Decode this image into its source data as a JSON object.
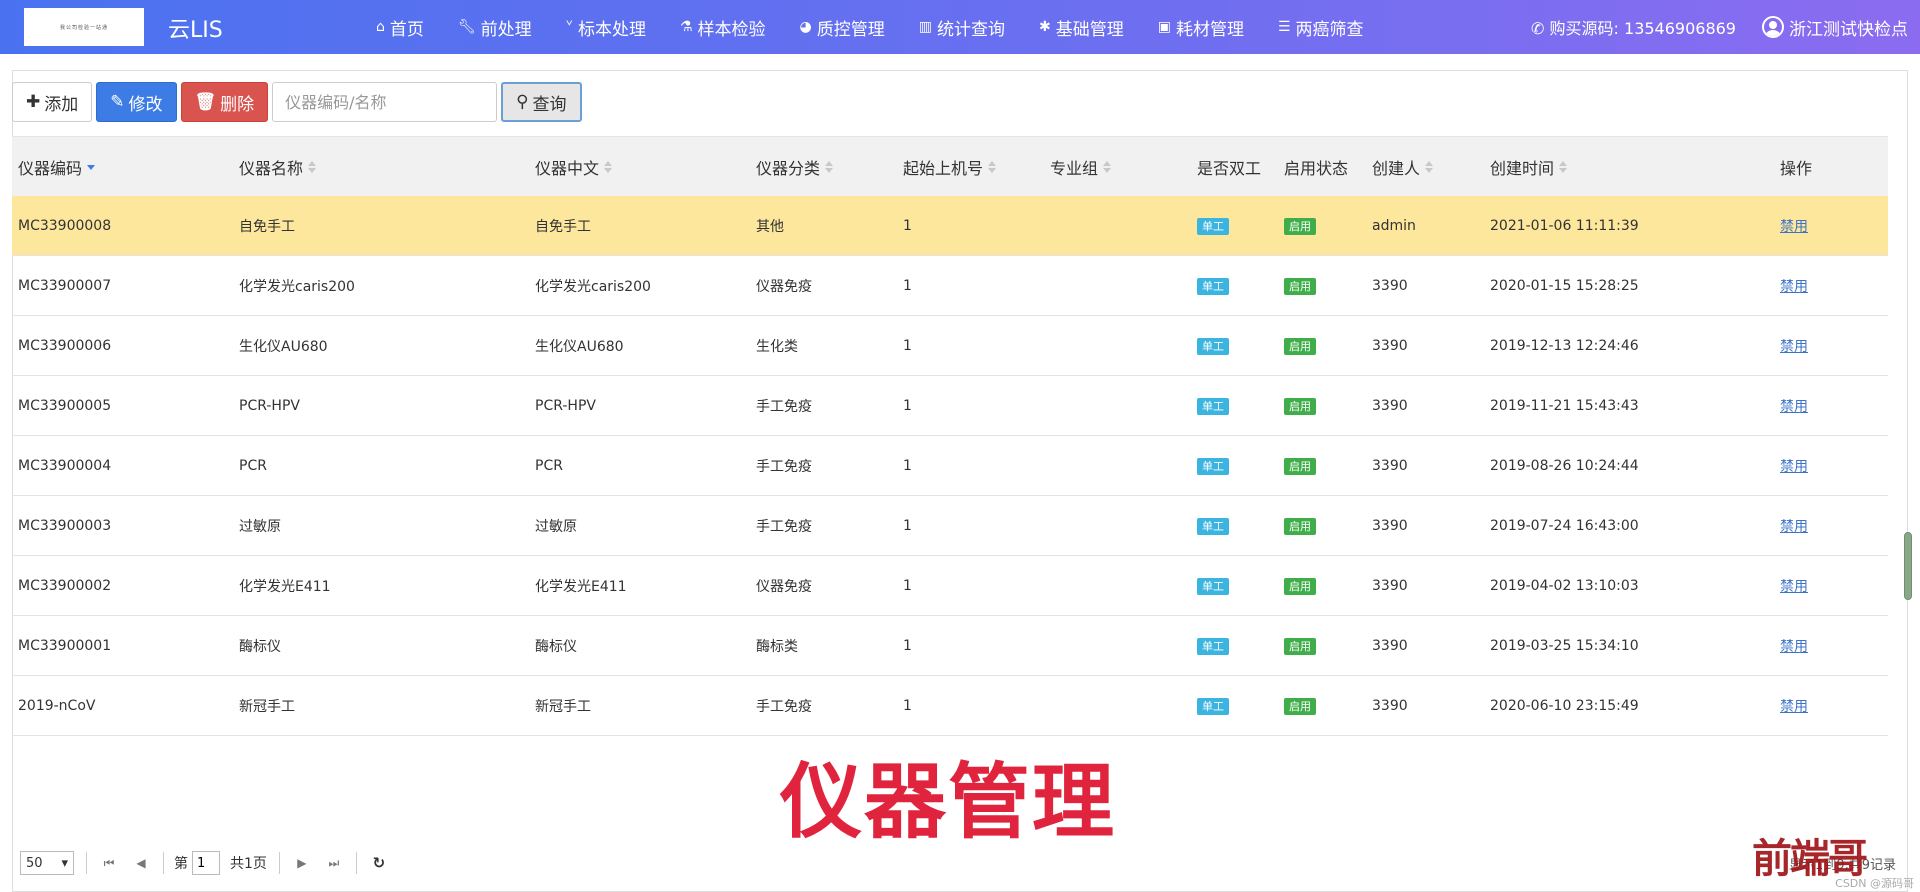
{
  "nav": {
    "logo_text": "我公司检验一站通",
    "brand": "云LIS",
    "menu": [
      {
        "icon": "home-icon",
        "label": "首页"
      },
      {
        "icon": "wrench-icon",
        "label": "前处理"
      },
      {
        "icon": "stethoscope-icon",
        "label": "标本处理"
      },
      {
        "icon": "flask-icon",
        "label": "样本检验"
      },
      {
        "icon": "pie-chart-icon",
        "label": "质控管理"
      },
      {
        "icon": "bar-chart-icon",
        "label": "统计查询"
      },
      {
        "icon": "gear-icon",
        "label": "基础管理"
      },
      {
        "icon": "briefcase-icon",
        "label": "耗材管理"
      },
      {
        "icon": "list-icon",
        "label": "两癌筛查"
      }
    ],
    "phone": "购买源码: 13546906869",
    "user": "浙江测试快检点"
  },
  "toolbar": {
    "add_label": "添加",
    "edit_label": "修改",
    "delete_label": "删除",
    "search_placeholder": "仪器编码/名称",
    "query_label": "查询"
  },
  "table": {
    "columns": [
      "仪器编码",
      "仪器名称",
      "仪器中文",
      "仪器分类",
      "起始上机号",
      "专业组",
      "是否双工",
      "启用状态",
      "创建人",
      "创建时间",
      "操作"
    ],
    "rows": [
      {
        "code": "MC33900008",
        "name": "自免手工",
        "cn": "自免手工",
        "cat": "其他",
        "start": "1",
        "group": "",
        "duplex": "单工",
        "status": "启用",
        "creator": "admin",
        "created": "2021-01-06 11:11:39",
        "action": "禁用"
      },
      {
        "code": "MC33900007",
        "name": "化学发光caris200",
        "cn": "化学发光caris200",
        "cat": "仪器免疫",
        "start": "1",
        "group": "",
        "duplex": "单工",
        "status": "启用",
        "creator": "3390",
        "created": "2020-01-15 15:28:25",
        "action": "禁用"
      },
      {
        "code": "MC33900006",
        "name": "生化仪AU680",
        "cn": "生化仪AU680",
        "cat": "生化类",
        "start": "1",
        "group": "",
        "duplex": "单工",
        "status": "启用",
        "creator": "3390",
        "created": "2019-12-13 12:24:46",
        "action": "禁用"
      },
      {
        "code": "MC33900005",
        "name": "PCR-HPV",
        "cn": "PCR-HPV",
        "cat": "手工免疫",
        "start": "1",
        "group": "",
        "duplex": "单工",
        "status": "启用",
        "creator": "3390",
        "created": "2019-11-21 15:43:43",
        "action": "禁用"
      },
      {
        "code": "MC33900004",
        "name": "PCR",
        "cn": "PCR",
        "cat": "手工免疫",
        "start": "1",
        "group": "",
        "duplex": "单工",
        "status": "启用",
        "creator": "3390",
        "created": "2019-08-26 10:24:44",
        "action": "禁用"
      },
      {
        "code": "MC33900003",
        "name": "过敏原",
        "cn": "过敏原",
        "cat": "手工免疫",
        "start": "1",
        "group": "",
        "duplex": "单工",
        "status": "启用",
        "creator": "3390",
        "created": "2019-07-24 16:43:00",
        "action": "禁用"
      },
      {
        "code": "MC33900002",
        "name": "化学发光E411",
        "cn": "化学发光E411",
        "cat": "仪器免疫",
        "start": "1",
        "group": "",
        "duplex": "单工",
        "status": "启用",
        "creator": "3390",
        "created": "2019-04-02 13:10:03",
        "action": "禁用"
      },
      {
        "code": "MC33900001",
        "name": "酶标仪",
        "cn": "酶标仪",
        "cat": "酶标类",
        "start": "1",
        "group": "",
        "duplex": "单工",
        "status": "启用",
        "creator": "3390",
        "created": "2019-03-25 15:34:10",
        "action": "禁用"
      },
      {
        "code": "2019-nCoV",
        "name": "新冠手工",
        "cn": "新冠手工",
        "cat": "手工免疫",
        "start": "1",
        "group": "",
        "duplex": "单工",
        "status": "启用",
        "creator": "3390",
        "created": "2020-06-10 23:15:49",
        "action": "禁用"
      }
    ]
  },
  "overlay": {
    "title": "仪器管理",
    "corner_logo": "前端哥",
    "csdn": "CSDN @源码哥"
  },
  "pager": {
    "page_size": "50",
    "page_prefix": "第",
    "page_value": "1",
    "page_total": "共1页",
    "info": "显示1到9,共9记录"
  }
}
